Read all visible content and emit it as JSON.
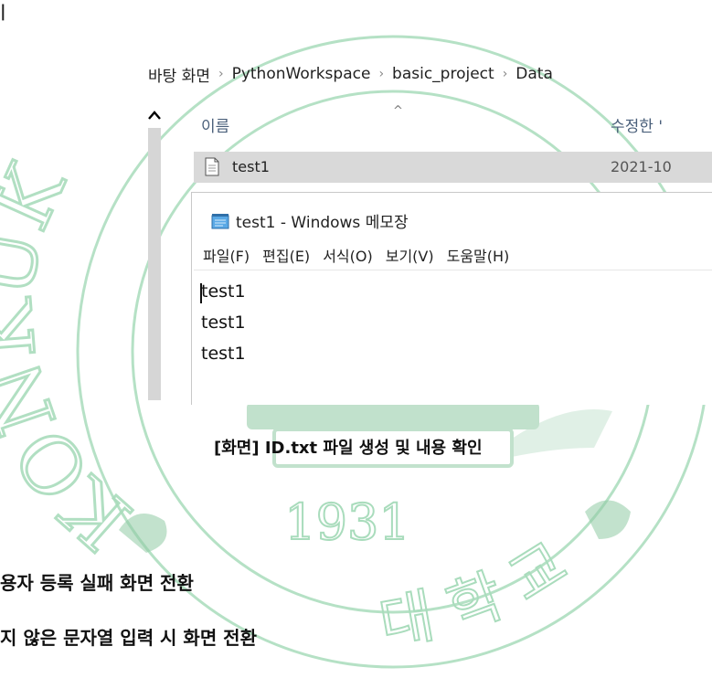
{
  "stray_fragment": "|",
  "explorer": {
    "breadcrumb": [
      "바탕 화면",
      "PythonWorkspace",
      "basic_project",
      "Data"
    ],
    "column_name": "이름",
    "column_date": "수정한 '",
    "file": {
      "name": "test1",
      "date": "2021-10"
    }
  },
  "notepad": {
    "title": "test1 - Windows 메모장",
    "menu": [
      "파일(F)",
      "편집(E)",
      "서식(O)",
      "보기(V)",
      "도움말(H)"
    ],
    "lines": [
      "test1",
      "test1",
      "test1"
    ]
  },
  "caption": "[화면] ID.txt 파일 생성 및 내용 확인",
  "heading_1": "용자 등록 실패 화면 전환",
  "heading_2": "지 않은 문자열 입력 시 화면 전환",
  "colors": {
    "seal_green": "#6fb98a",
    "row_highlight": "#d9d9d9"
  },
  "watermark_year": "1931",
  "watermark_text": "KONKUK"
}
